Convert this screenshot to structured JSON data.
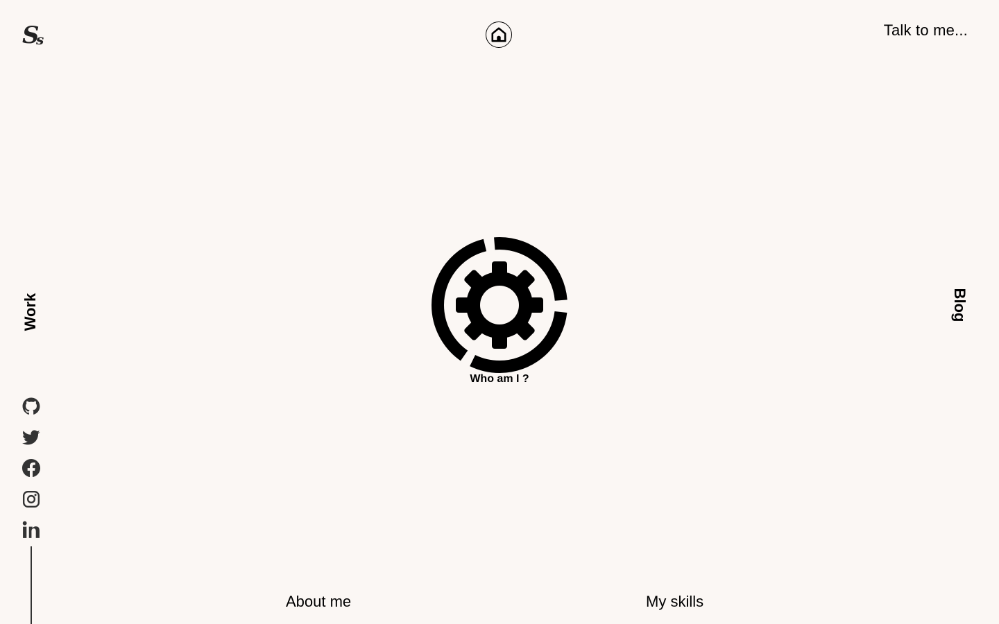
{
  "header": {
    "logo_text": "Ss",
    "home_icon": "home-icon",
    "talk_label": "Talk to me..."
  },
  "side_nav": {
    "work_label": "Work",
    "blog_label": "Blog"
  },
  "social": [
    {
      "name": "github",
      "icon": "github-icon"
    },
    {
      "name": "twitter",
      "icon": "twitter-icon"
    },
    {
      "name": "facebook",
      "icon": "facebook-icon"
    },
    {
      "name": "instagram",
      "icon": "instagram-icon"
    },
    {
      "name": "linkedin",
      "icon": "linkedin-icon"
    }
  ],
  "center": {
    "icon": "gear-icon",
    "label": "Who am I ?"
  },
  "bottom_nav": {
    "about_label": "About me",
    "skills_label": "My skills"
  },
  "colors": {
    "background": "#fbf7f4",
    "foreground": "#000000"
  }
}
